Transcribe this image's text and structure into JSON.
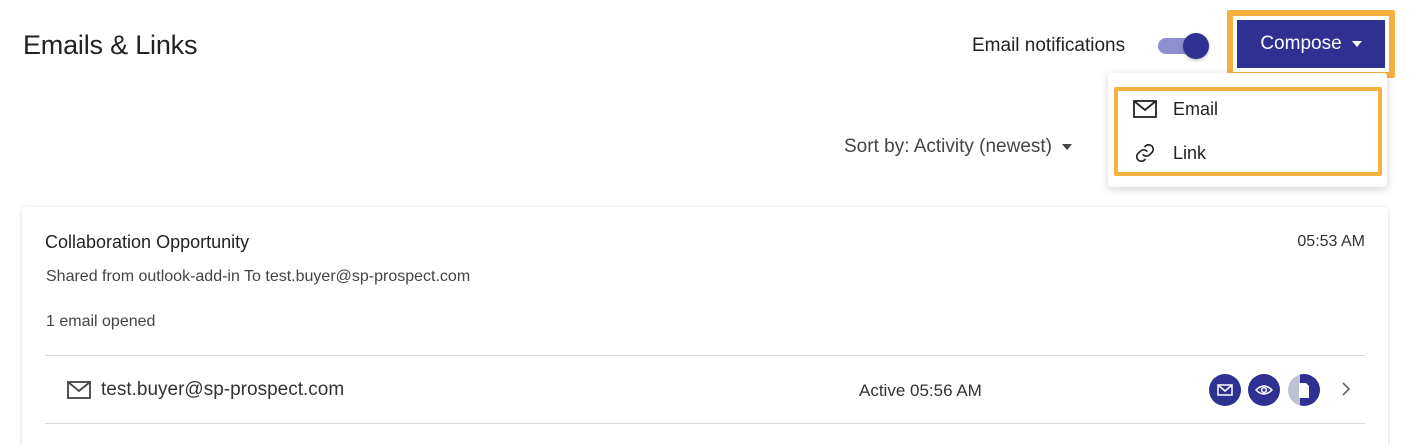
{
  "header": {
    "title": "Emails & Links",
    "notifications_label": "Email notifications",
    "notifications_enabled": true,
    "compose_label": "Compose"
  },
  "compose_menu": {
    "items": [
      {
        "label": "Email",
        "icon": "envelope-icon"
      },
      {
        "label": "Link",
        "icon": "link-icon"
      }
    ]
  },
  "sort": {
    "label": "Sort by: Activity (newest)"
  },
  "cards": [
    {
      "title": "Collaboration Opportunity",
      "time": "05:53 AM",
      "subtitle": "Shared from outlook-add-in To test.buyer@sp-prospect.com",
      "opened": "1 email opened",
      "recipients": [
        {
          "email": "test.buyer@sp-prospect.com",
          "status": "Active 05:56 AM",
          "badges": [
            "envelope-icon",
            "eye-icon",
            "document-icon"
          ]
        }
      ]
    }
  ],
  "colors": {
    "primary": "#2e3192",
    "toggle_track": "#8f8fcf",
    "highlight": "#f5b042",
    "divider": "#d9d9d9"
  }
}
